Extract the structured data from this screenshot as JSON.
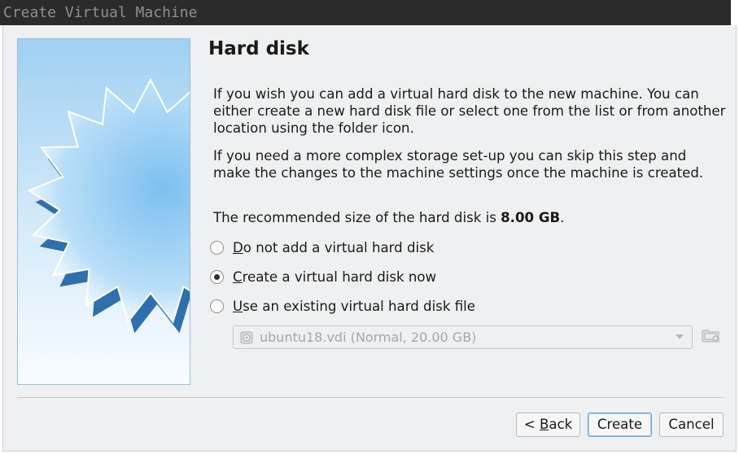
{
  "window": {
    "title": "Create Virtual Machine"
  },
  "page": {
    "heading": "Hard disk",
    "para1": "If you wish you can add a virtual hard disk to the new machine. You can either create a new hard disk file or select one from the list or from another location using the folder icon.",
    "para2": "If you need a more complex storage set-up you can skip this step and make the changes to the machine settings once the machine is created.",
    "para3_prefix": "The recommended size of the hard disk is ",
    "para3_size": "8.00 GB",
    "para3_suffix": "."
  },
  "options": [
    {
      "mnemonic": "D",
      "rest": "o not add a virtual hard disk",
      "selected": false
    },
    {
      "mnemonic": "C",
      "rest": "reate a virtual hard disk now",
      "selected": true
    },
    {
      "mnemonic": "U",
      "rest": "se an existing virtual hard disk file",
      "selected": false
    }
  ],
  "disk_select": {
    "value": "ubuntu18.vdi (Normal, 20.00 GB)",
    "enabled": false
  },
  "buttons": {
    "back_prefix": "< ",
    "back_mnemonic": "B",
    "back_rest": "ack",
    "create": "Create",
    "cancel": "Cancel"
  },
  "colors": {
    "accent": "#3a8fd6",
    "window_bg": "#eff0f1"
  }
}
